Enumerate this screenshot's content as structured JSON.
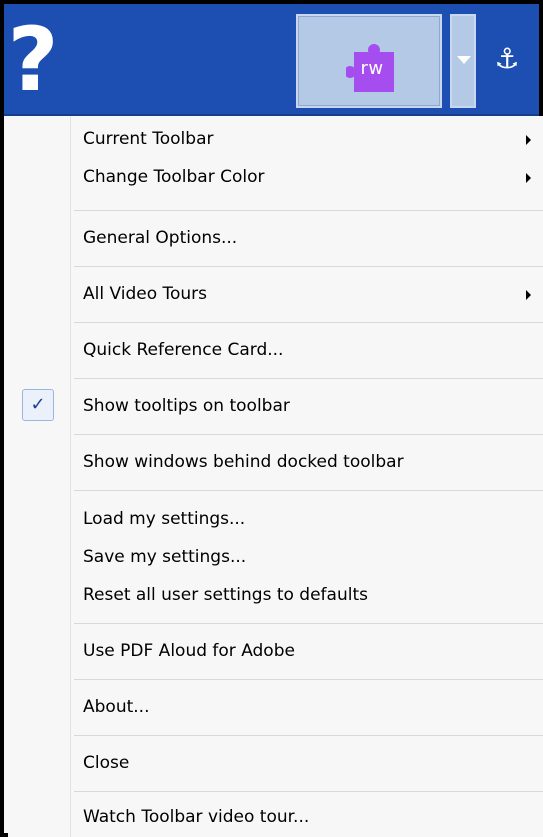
{
  "toolbar": {
    "help_icon": "question-mark-icon",
    "rw_label": "rw",
    "rw_icon": "puzzle-piece-icon",
    "anchor_icon": "anchor-icon",
    "colors": {
      "toolbar_bg": "#1c4fb1",
      "button_bg": "#b3c9e5",
      "puzzle": "#a64df0"
    }
  },
  "menu": {
    "current_toolbar": "Current Toolbar",
    "change_toolbar_color": "Change Toolbar Color",
    "general_options": "General Options...",
    "all_video_tours": "All Video Tours",
    "quick_reference_card": "Quick Reference Card...",
    "show_tooltips": "Show tooltips on toolbar",
    "show_tooltips_checked": true,
    "show_windows_behind": "Show windows behind docked toolbar",
    "load_settings": "Load my settings...",
    "save_settings": "Save my settings...",
    "reset_settings": "Reset all user settings to defaults",
    "use_pdf_aloud": "Use PDF Aloud for Adobe",
    "about": "About...",
    "close": "Close",
    "watch_video_tour": "Watch Toolbar video tour..."
  }
}
